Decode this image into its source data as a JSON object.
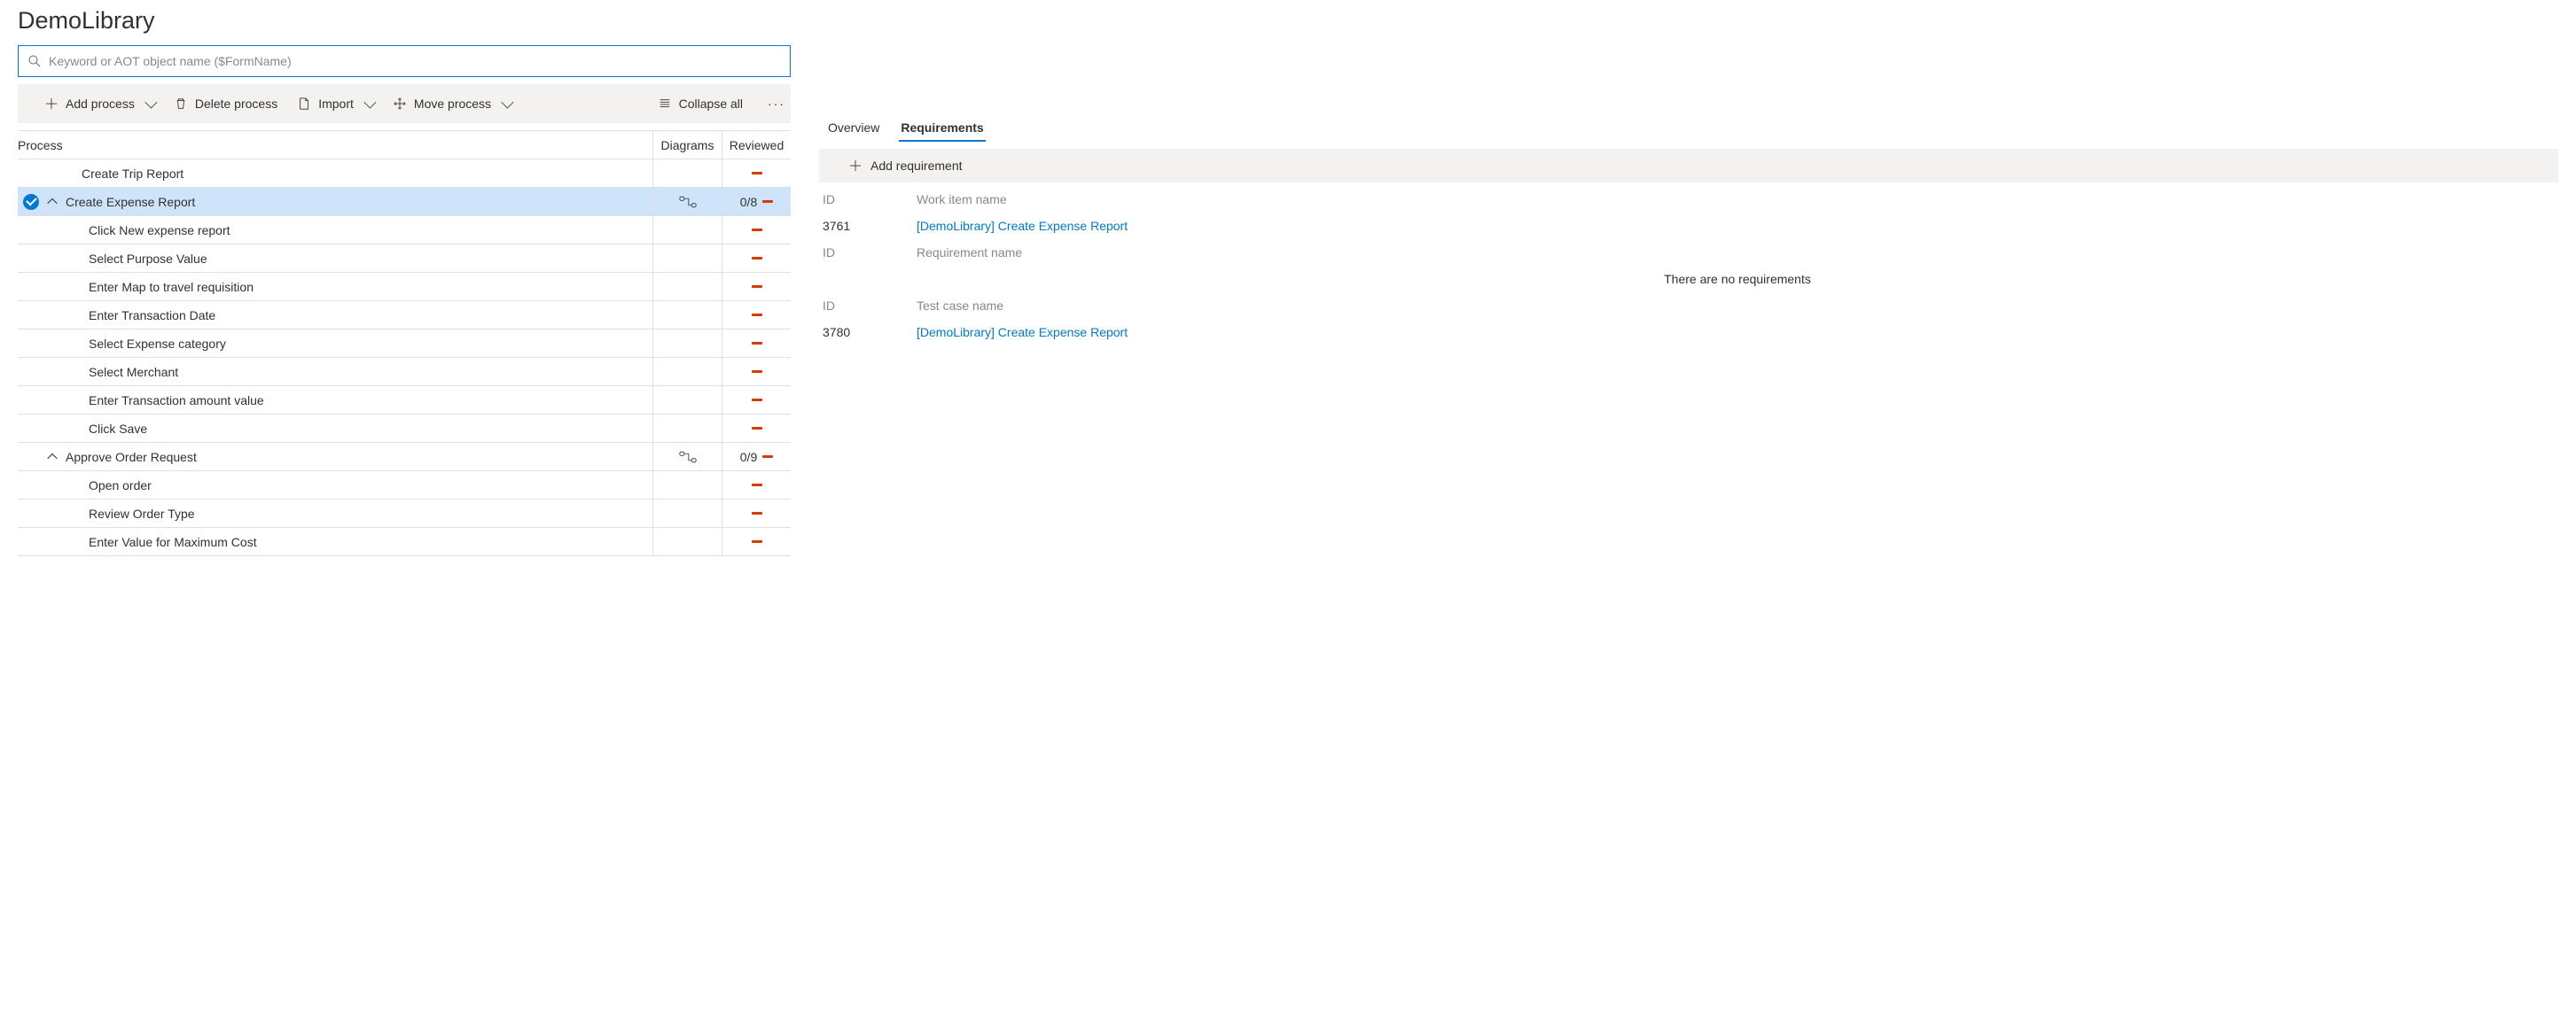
{
  "page_title": "DemoLibrary",
  "search": {
    "placeholder": "Keyword or AOT object name ($FormName)"
  },
  "toolbar": {
    "add_process": "Add process",
    "delete_process": "Delete process",
    "import": "Import",
    "move_process": "Move process",
    "collapse_all": "Collapse all"
  },
  "grid": {
    "headers": {
      "process": "Process",
      "diagrams": "Diagrams",
      "reviewed": "Reviewed"
    },
    "rows": [
      {
        "label": "Create Trip Report",
        "level": 1,
        "selected": false,
        "expander": false,
        "diagram": false,
        "count": "",
        "minus": true
      },
      {
        "label": "Create Expense Report",
        "level": 1,
        "selected": true,
        "expander": true,
        "diagram": true,
        "count": "0/8",
        "minus": true
      },
      {
        "label": "Click New expense report",
        "level": 2,
        "selected": false,
        "expander": false,
        "diagram": false,
        "count": "",
        "minus": true
      },
      {
        "label": "Select Purpose Value",
        "level": 2,
        "selected": false,
        "expander": false,
        "diagram": false,
        "count": "",
        "minus": true
      },
      {
        "label": "Enter Map to travel requisition",
        "level": 2,
        "selected": false,
        "expander": false,
        "diagram": false,
        "count": "",
        "minus": true
      },
      {
        "label": "Enter Transaction Date",
        "level": 2,
        "selected": false,
        "expander": false,
        "diagram": false,
        "count": "",
        "minus": true
      },
      {
        "label": "Select Expense category",
        "level": 2,
        "selected": false,
        "expander": false,
        "diagram": false,
        "count": "",
        "minus": true
      },
      {
        "label": "Select Merchant",
        "level": 2,
        "selected": false,
        "expander": false,
        "diagram": false,
        "count": "",
        "minus": true
      },
      {
        "label": "Enter Transaction amount value",
        "level": 2,
        "selected": false,
        "expander": false,
        "diagram": false,
        "count": "",
        "minus": true
      },
      {
        "label": "Click Save",
        "level": 2,
        "selected": false,
        "expander": false,
        "diagram": false,
        "count": "",
        "minus": true
      },
      {
        "label": "Approve Order Request",
        "level": 1,
        "selected": false,
        "expander": true,
        "diagram": true,
        "count": "0/9",
        "minus": true
      },
      {
        "label": "Open order",
        "level": 2,
        "selected": false,
        "expander": false,
        "diagram": false,
        "count": "",
        "minus": true
      },
      {
        "label": "Review Order Type",
        "level": 2,
        "selected": false,
        "expander": false,
        "diagram": false,
        "count": "",
        "minus": true
      },
      {
        "label": "Enter Value for Maximum Cost",
        "level": 2,
        "selected": false,
        "expander": false,
        "diagram": false,
        "count": "",
        "minus": true
      }
    ]
  },
  "right": {
    "tabs": {
      "overview": "Overview",
      "requirements": "Requirements"
    },
    "add_requirement": "Add requirement",
    "sections": [
      {
        "id_label": "ID",
        "name_label": "Work item name",
        "rows": [
          {
            "id": "3761",
            "name": "[DemoLibrary] Create Expense Report",
            "link": true
          }
        ]
      },
      {
        "id_label": "ID",
        "name_label": "Requirement name",
        "rows": [
          {
            "id": "",
            "name": "There are no requirements",
            "link": false,
            "empty": true
          }
        ]
      },
      {
        "id_label": "ID",
        "name_label": "Test case name",
        "rows": [
          {
            "id": "3780",
            "name": "[DemoLibrary] Create Expense Report",
            "link": true
          }
        ]
      }
    ]
  }
}
